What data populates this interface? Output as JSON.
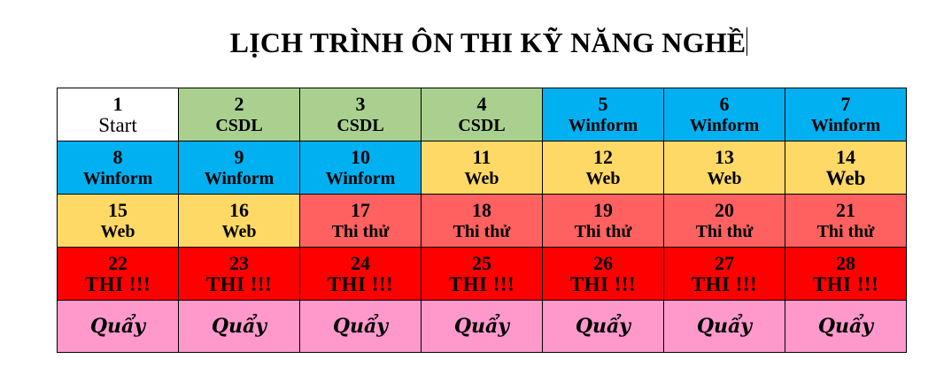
{
  "title": "LỊCH TRÌNH ÔN THI KỸ NĂNG NGHỀ",
  "colors": {
    "white": "#ffffff",
    "green": "#a9d08e",
    "blue": "#00b0f0",
    "yellow": "#ffd966",
    "salmon": "#ff6161",
    "red": "#ff0000",
    "pink": "#ff99cc"
  },
  "schedule": {
    "rows": [
      [
        {
          "day": "1",
          "label": "Start",
          "color": "white"
        },
        {
          "day": "2",
          "label": "CSDL",
          "color": "green"
        },
        {
          "day": "3",
          "label": "CSDL",
          "color": "green"
        },
        {
          "day": "4",
          "label": "CSDL",
          "color": "green"
        },
        {
          "day": "5",
          "label": "Winform",
          "color": "blue"
        },
        {
          "day": "6",
          "label": "Winform",
          "color": "blue"
        },
        {
          "day": "7",
          "label": "Winform",
          "color": "blue"
        }
      ],
      [
        {
          "day": "8",
          "label": "Winform",
          "color": "blue"
        },
        {
          "day": "9",
          "label": "Winform",
          "color": "blue"
        },
        {
          "day": "10",
          "label": "Winform",
          "color": "blue"
        },
        {
          "day": "11",
          "label": "Web",
          "color": "yellow"
        },
        {
          "day": "12",
          "label": "Web",
          "color": "yellow"
        },
        {
          "day": "13",
          "label": "Web",
          "color": "yellow"
        },
        {
          "day": "14",
          "label": "Web",
          "color": "yellow"
        }
      ],
      [
        {
          "day": "15",
          "label": "Web",
          "color": "yellow"
        },
        {
          "day": "16",
          "label": "Web",
          "color": "yellow"
        },
        {
          "day": "17",
          "label": "Thi thử",
          "color": "salmon"
        },
        {
          "day": "18",
          "label": "Thi thử",
          "color": "salmon"
        },
        {
          "day": "19",
          "label": "Thi thử",
          "color": "salmon"
        },
        {
          "day": "20",
          "label": "Thi thử",
          "color": "salmon"
        },
        {
          "day": "21",
          "label": "Thi thử",
          "color": "salmon"
        }
      ],
      [
        {
          "day": "22",
          "label": "THI !!!",
          "color": "red"
        },
        {
          "day": "23",
          "label": "THI !!!",
          "color": "red"
        },
        {
          "day": "24",
          "label": "THI !!!",
          "color": "red"
        },
        {
          "day": "25",
          "label": "THI !!!",
          "color": "red"
        },
        {
          "day": "26",
          "label": "THI !!!",
          "color": "red"
        },
        {
          "day": "27",
          "label": "THI !!!",
          "color": "red"
        },
        {
          "day": "28",
          "label": "THI !!!",
          "color": "red"
        }
      ],
      [
        {
          "label": "Quẩy",
          "color": "pink"
        },
        {
          "label": "Quẩy",
          "color": "pink"
        },
        {
          "label": "Quẩy",
          "color": "pink"
        },
        {
          "label": "Quẩy",
          "color": "pink"
        },
        {
          "label": "Quẩy",
          "color": "pink"
        },
        {
          "label": "Quẩy",
          "color": "pink"
        },
        {
          "label": "Quẩy",
          "color": "pink"
        }
      ]
    ]
  }
}
